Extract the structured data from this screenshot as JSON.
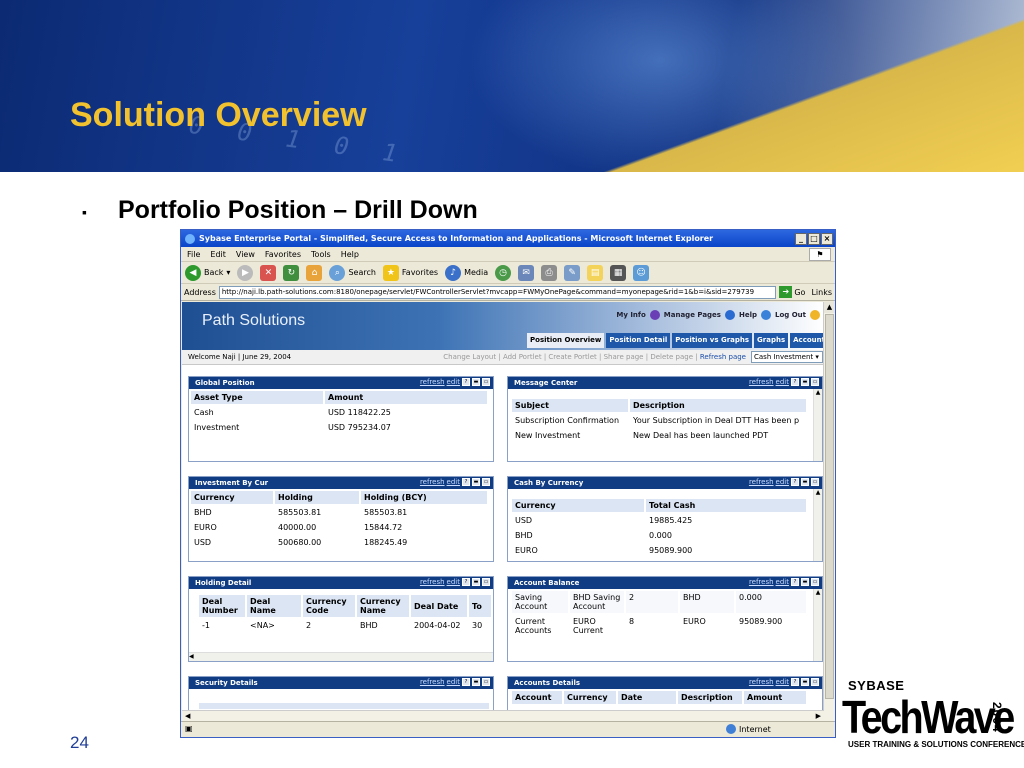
{
  "slide": {
    "title": "Solution Overview",
    "bullet": "▪",
    "subtitle": "Portfolio Position – Drill Down",
    "number": "24",
    "digits": "0 0 1 0 1",
    "logo": {
      "brand": "SYBASE",
      "name": "TechWave",
      "year": "2004",
      "tagline": "USER TRAINING & SOLUTIONS CONFERENCE"
    }
  },
  "browser": {
    "title": "Sybase Enterprise Portal - Simplified, Secure Access to Information and Applications - Microsoft Internet Explorer",
    "menu": [
      "File",
      "Edit",
      "View",
      "Favorites",
      "Tools",
      "Help"
    ],
    "toolbar": {
      "back": "Back",
      "search": "Search",
      "favorites": "Favorites",
      "media": "Media"
    },
    "address_label": "Address",
    "url": "http://naji.lb.path-solutions.com:8180/onepage/servlet/FWControllerServlet?mvcapp=FWMyOnePage&command=myonepage&rid=1&b=i&sid=279739",
    "go": "Go",
    "links": "Links",
    "status_zone": "Internet"
  },
  "portal": {
    "brand": "Path Solutions",
    "top_links": [
      "My Info",
      "Manage Pages",
      "Help",
      "Log Out"
    ],
    "tabs": [
      "Position Overview",
      "Position Detail",
      "Position vs Graphs",
      "Graphs",
      "Accounts"
    ],
    "welcome": "Welcome Naji | June 29, 2004",
    "actions": [
      "Change Layout",
      "Add Portlet",
      "Create Portlet",
      "Share page",
      "Delete page"
    ],
    "refresh_page": "Refresh page",
    "page_select": "Cash Investment",
    "ctl_refresh": "refresh",
    "ctl_edit": "edit"
  },
  "portlets": {
    "global_position": {
      "title": "Global Position",
      "headers": [
        "Asset Type",
        "Amount"
      ],
      "rows": [
        [
          "Cash",
          "USD 118422.25"
        ],
        [
          "Investment",
          "USD 795234.07"
        ]
      ]
    },
    "message_center": {
      "title": "Message Center",
      "headers": [
        "Subject",
        "Description"
      ],
      "rows": [
        [
          "Subscription Confirmation",
          "Your Subscription in Deal DTT Has been p"
        ],
        [
          "New Investment",
          "New Deal has been launched PDT"
        ]
      ]
    },
    "investment_by_cur": {
      "title": "Investment By Cur",
      "headers": [
        "Currency",
        "Holding",
        "Holding (BCY)"
      ],
      "rows": [
        [
          "BHD",
          "585503.81",
          "585503.81"
        ],
        [
          "EURO",
          "40000.00",
          "15844.72"
        ],
        [
          "USD",
          "500680.00",
          "188245.49"
        ]
      ]
    },
    "cash_by_currency": {
      "title": "Cash By Currency",
      "headers": [
        "Currency",
        "Total Cash"
      ],
      "rows": [
        [
          "USD",
          "19885.425"
        ],
        [
          "BHD",
          "0.000"
        ],
        [
          "EURO",
          "95089.900"
        ]
      ]
    },
    "holding_detail": {
      "title": "Holding Detail",
      "headers": [
        "Deal Number",
        "Deal Name",
        "Currency Code",
        "Currency Name",
        "Deal Date",
        "To"
      ],
      "rows": [
        [
          "-1",
          "<NA>",
          "2",
          "BHD",
          "2004-04-02",
          "30"
        ]
      ]
    },
    "account_balance": {
      "title": "Account Balance",
      "rows": [
        [
          "Saving Account",
          "BHD Saving Account",
          "2",
          "BHD",
          "0.000"
        ],
        [
          "Current Accounts",
          "EURO Current",
          "8",
          "EURO",
          "95089.900"
        ]
      ]
    },
    "security_details": {
      "title": "Security Details"
    },
    "accounts_details": {
      "title": "Accounts Details",
      "headers": [
        "Account",
        "Currency",
        "Date",
        "Description",
        "Amount"
      ]
    }
  }
}
